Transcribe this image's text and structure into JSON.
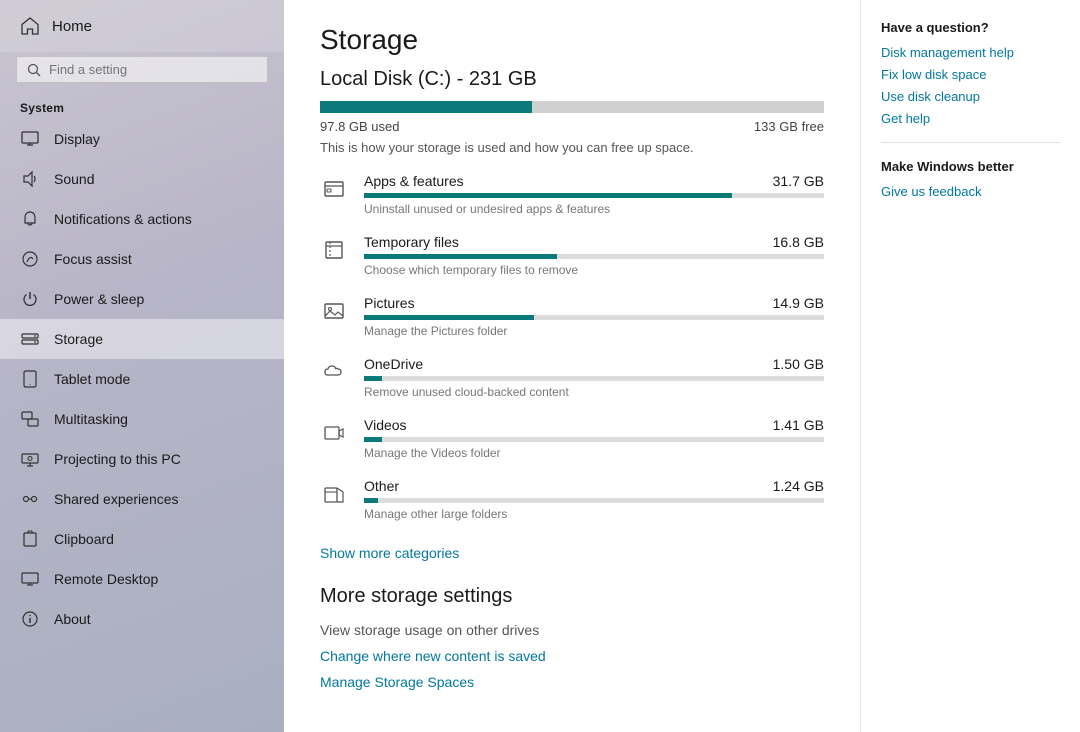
{
  "sidebar": {
    "home_label": "Home",
    "search_placeholder": "Find a setting",
    "system_label": "System",
    "items": [
      {
        "id": "display",
        "label": "Display",
        "icon": "display"
      },
      {
        "id": "sound",
        "label": "Sound",
        "icon": "sound"
      },
      {
        "id": "notifications",
        "label": "Notifications & actions",
        "icon": "notifications"
      },
      {
        "id": "focus",
        "label": "Focus assist",
        "icon": "focus"
      },
      {
        "id": "power",
        "label": "Power & sleep",
        "icon": "power"
      },
      {
        "id": "storage",
        "label": "Storage",
        "icon": "storage",
        "active": true
      },
      {
        "id": "tablet",
        "label": "Tablet mode",
        "icon": "tablet"
      },
      {
        "id": "multitasking",
        "label": "Multitasking",
        "icon": "multitasking"
      },
      {
        "id": "projecting",
        "label": "Projecting to this PC",
        "icon": "projecting"
      },
      {
        "id": "shared",
        "label": "Shared experiences",
        "icon": "shared"
      },
      {
        "id": "clipboard",
        "label": "Clipboard",
        "icon": "clipboard"
      },
      {
        "id": "remote",
        "label": "Remote Desktop",
        "icon": "remote"
      },
      {
        "id": "about",
        "label": "About",
        "icon": "about"
      }
    ]
  },
  "main": {
    "page_title": "Storage",
    "disk_title": "Local Disk (C:) - 231 GB",
    "used_label": "97.8 GB used",
    "free_label": "133 GB free",
    "used_percent": 42,
    "storage_desc": "This is how your storage is used and how you can free up space.",
    "items": [
      {
        "name": "Apps & features",
        "size": "31.7 GB",
        "desc": "Uninstall unused or undesired apps & features",
        "bar_percent": 80,
        "icon": "apps"
      },
      {
        "name": "Temporary files",
        "size": "16.8 GB",
        "desc": "Choose which temporary files to remove",
        "bar_percent": 42,
        "icon": "temp"
      },
      {
        "name": "Pictures",
        "size": "14.9 GB",
        "desc": "Manage the Pictures folder",
        "bar_percent": 37,
        "icon": "pictures"
      },
      {
        "name": "OneDrive",
        "size": "1.50 GB",
        "desc": "Remove unused cloud-backed content",
        "bar_percent": 4,
        "icon": "onedrive"
      },
      {
        "name": "Videos",
        "size": "1.41 GB",
        "desc": "Manage the Videos folder",
        "bar_percent": 4,
        "icon": "videos"
      },
      {
        "name": "Other",
        "size": "1.24 GB",
        "desc": "Manage other large folders",
        "bar_percent": 3,
        "icon": "other"
      }
    ],
    "show_more_label": "Show more categories",
    "more_storage_title": "More storage settings",
    "view_storage_label": "View storage usage on other drives",
    "change_content_label": "Change where new content is saved",
    "manage_spaces_label": "Manage Storage Spaces"
  },
  "right_panel": {
    "have_question": "Have a question?",
    "links": [
      "Disk management help",
      "Fix low disk space",
      "Use disk cleanup",
      "Get help"
    ],
    "make_better": "Make Windows better",
    "feedback_label": "Give us feedback"
  }
}
